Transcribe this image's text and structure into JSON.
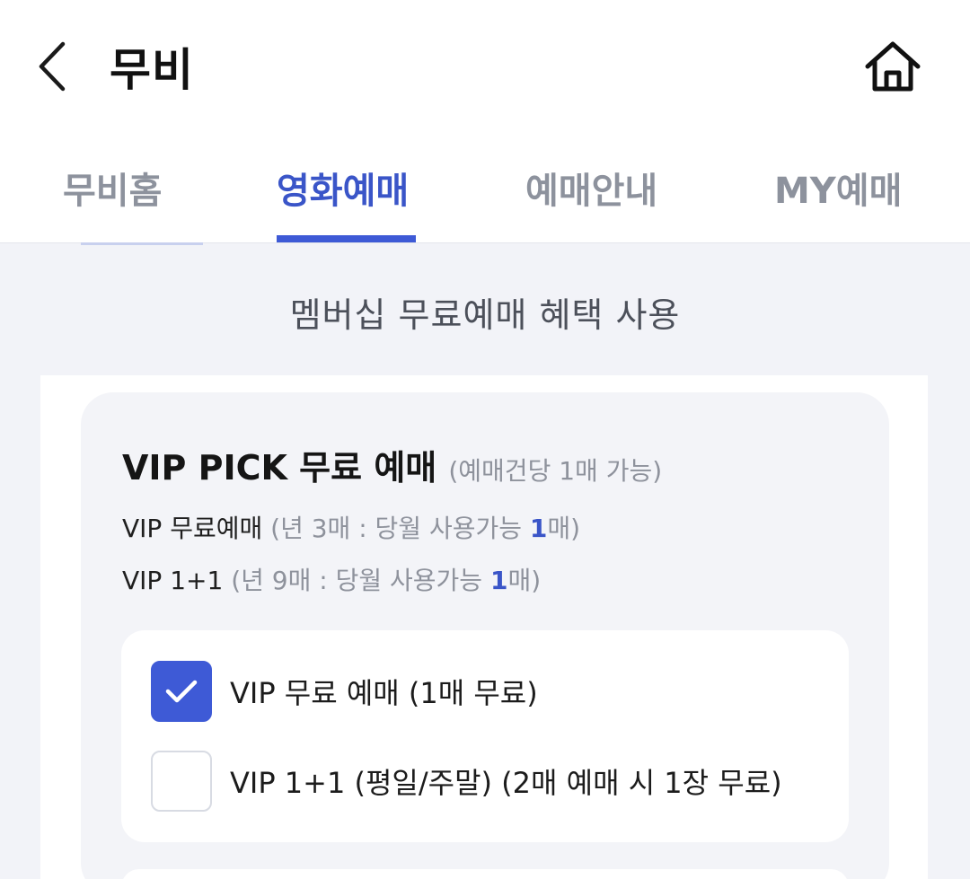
{
  "header": {
    "title": "무비",
    "back_icon": "chevron-left-icon",
    "home_icon": "home-icon"
  },
  "tabs": [
    {
      "label": "무비홈",
      "active": false
    },
    {
      "label": "영화예매",
      "active": true
    },
    {
      "label": "예매안내",
      "active": false
    },
    {
      "label": "MY예매",
      "active": false
    }
  ],
  "section": {
    "title": "멤버십 무료예매 혜택 사용"
  },
  "card": {
    "heading": "VIP PICK 무료 예매",
    "heading_note": "(예매건당 1매 가능)",
    "lines": [
      {
        "name": "VIP 무료예매",
        "detail_prefix": "(년 3매 : 당월 사용가능 ",
        "count": "1",
        "detail_suffix": "매)"
      },
      {
        "name": "VIP 1+1",
        "detail_prefix": "(년 9매 : 당월 사용가능 ",
        "count": "1",
        "detail_suffix": "매)"
      }
    ],
    "options": [
      {
        "label": "VIP 무료 예매 (1매 무료)",
        "checked": true
      },
      {
        "label": "VIP 1+1 (평일/주말) (2매 예매 시 1장 무료)",
        "checked": false
      }
    ]
  },
  "colors": {
    "accent": "#3e5ad6",
    "accent_text": "#3a55c8",
    "muted_text": "#8e929c",
    "background": "#f2f3f8"
  }
}
